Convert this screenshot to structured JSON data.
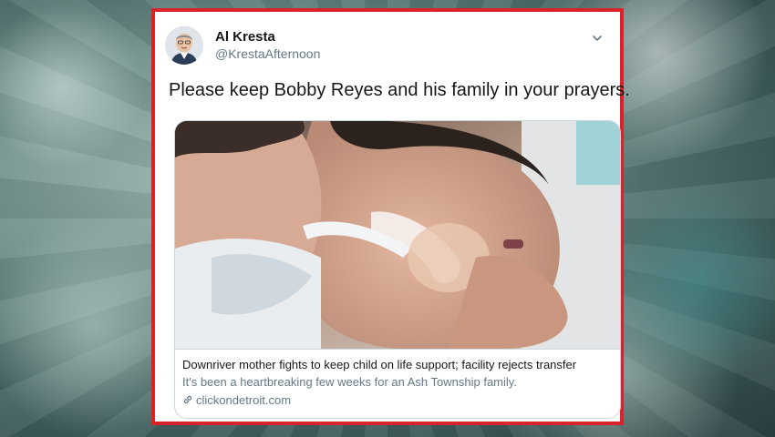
{
  "tweet": {
    "author_name": "Al Kresta",
    "author_handle": "@KrestaAfternoon",
    "text": "Please keep Bobby Reyes and his family in your prayers.",
    "menu_icon": "chevron-down-icon"
  },
  "card": {
    "title": "Downriver mother fights to keep child on life support; facility rejects transfer",
    "description": "It's been a heartbreaking few weeks for an Ash Township family.",
    "domain": "clickondetroit.com",
    "link_icon": "link-icon"
  },
  "colors": {
    "frame_border": "#d9232b",
    "text_primary": "#14171a",
    "text_secondary": "#657786",
    "card_border": "#ccd6dd"
  }
}
